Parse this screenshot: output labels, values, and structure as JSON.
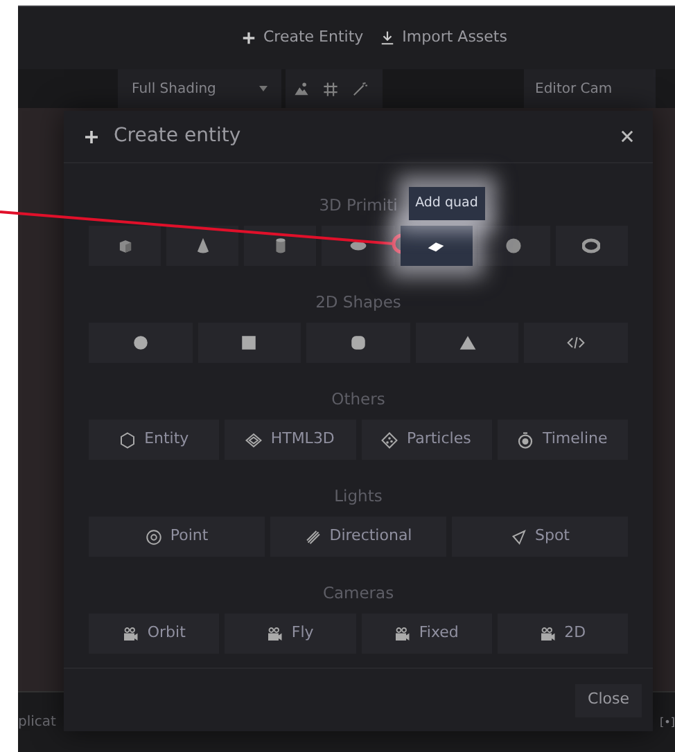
{
  "app_toolbar": {
    "buttons": [
      {
        "kind": "plus",
        "label": "Create Entity"
      },
      {
        "kind": "download",
        "label": "Import Assets"
      }
    ]
  },
  "viewport_bar": {
    "shading": "Full Shading",
    "camera": "Editor Cam"
  },
  "background": {
    "left_text": "plicat",
    "right_text": "[•]"
  },
  "dialog": {
    "title": "Create entity",
    "sections": [
      {
        "heading": "3D Primiti",
        "items": [
          {
            "kind": "cube",
            "selected": false
          },
          {
            "kind": "cone",
            "selected": false
          },
          {
            "kind": "cylinder",
            "selected": false
          },
          {
            "kind": "disc",
            "selected": false
          },
          {
            "kind": "quad",
            "selected": true
          },
          {
            "kind": "sphere",
            "selected": false
          },
          {
            "kind": "torus",
            "selected": false
          }
        ]
      },
      {
        "heading": "2D Shapes",
        "items": [
          {
            "kind": "circle"
          },
          {
            "kind": "square"
          },
          {
            "kind": "rounded"
          },
          {
            "kind": "triangle"
          },
          {
            "kind": "code"
          }
        ]
      },
      {
        "heading": "Others",
        "items": [
          {
            "kind": "hexagon",
            "label": "Entity"
          },
          {
            "kind": "diamond",
            "label": "HTML3D"
          },
          {
            "kind": "particles",
            "label": "Particles"
          },
          {
            "kind": "timer",
            "label": "Timeline"
          }
        ]
      },
      {
        "heading": "Lights",
        "items": [
          {
            "kind": "point",
            "label": "Point"
          },
          {
            "kind": "directional",
            "label": "Directional"
          },
          {
            "kind": "spot",
            "label": "Spot"
          }
        ]
      },
      {
        "heading": "Cameras",
        "items": [
          {
            "kind": "camera",
            "label": "Orbit"
          },
          {
            "kind": "camera",
            "label": "Fly"
          },
          {
            "kind": "camera",
            "label": "Fixed"
          },
          {
            "kind": "camera",
            "label": "2D"
          }
        ]
      }
    ],
    "close_button": "Close"
  },
  "tooltip": {
    "text": "Add quad"
  }
}
